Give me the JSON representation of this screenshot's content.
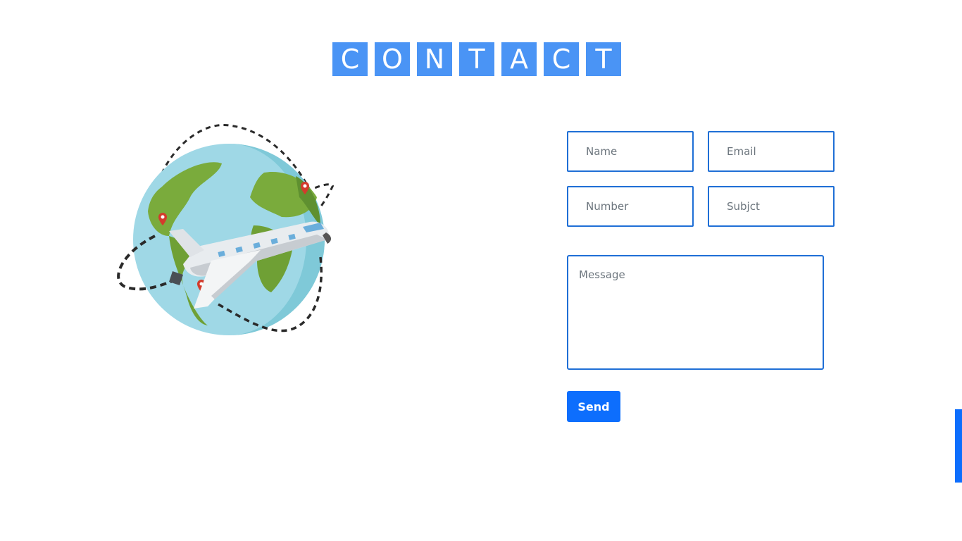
{
  "heading": {
    "letters": [
      "C",
      "O",
      "N",
      "T",
      "A",
      "C",
      "T"
    ]
  },
  "illustration": {
    "icon": "globe-airplane-illustration"
  },
  "form": {
    "name_placeholder": "Name",
    "email_placeholder": "Email",
    "number_placeholder": "Number",
    "subject_placeholder": "Subjct",
    "message_placeholder": "Message",
    "send_label": "Send"
  },
  "colors": {
    "accent": "#0d6efd",
    "title_tile": "#4a94f5",
    "field_border": "#1f6fd6"
  }
}
